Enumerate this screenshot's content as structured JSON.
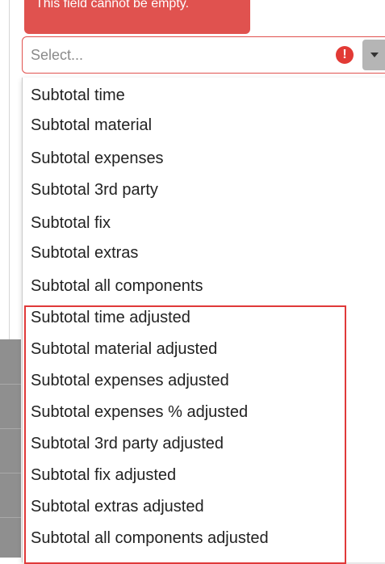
{
  "error_tooltip": {
    "text": "This field cannot be empty."
  },
  "select": {
    "placeholder": "Select...",
    "error_icon_glyph": "!"
  },
  "dropdown": {
    "items": [
      "Subtotal time",
      "Subtotal material",
      "Subtotal expenses",
      "Subtotal 3rd party",
      "Subtotal fix",
      "Subtotal extras",
      "Subtotal all components",
      "Subtotal time adjusted",
      "Subtotal material adjusted",
      "Subtotal expenses adjusted",
      "Subtotal expenses % adjusted",
      "Subtotal 3rd party adjusted",
      "Subtotal fix adjusted",
      "Subtotal extras adjusted",
      "Subtotal all components adjusted"
    ]
  },
  "colors": {
    "error": "#e0524f",
    "highlight": "#e03a3a"
  }
}
